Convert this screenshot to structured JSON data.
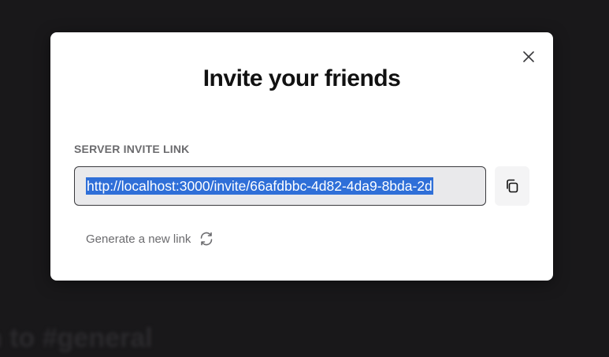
{
  "background": {
    "channel_text": "n to #general"
  },
  "modal": {
    "title": "Invite your friends",
    "close_icon": "close-icon",
    "section_label": "SERVER INVITE LINK",
    "invite_link": "http://localhost:3000/invite/66afdbbc-4d82-4da9-8bda-2d",
    "copy_icon": "copy-icon",
    "generate_label": "Generate a new link",
    "refresh_icon": "refresh-icon"
  },
  "colors": {
    "selection": "#2f6fd8",
    "modal_bg": "#ffffff",
    "backdrop": "#19181a"
  }
}
